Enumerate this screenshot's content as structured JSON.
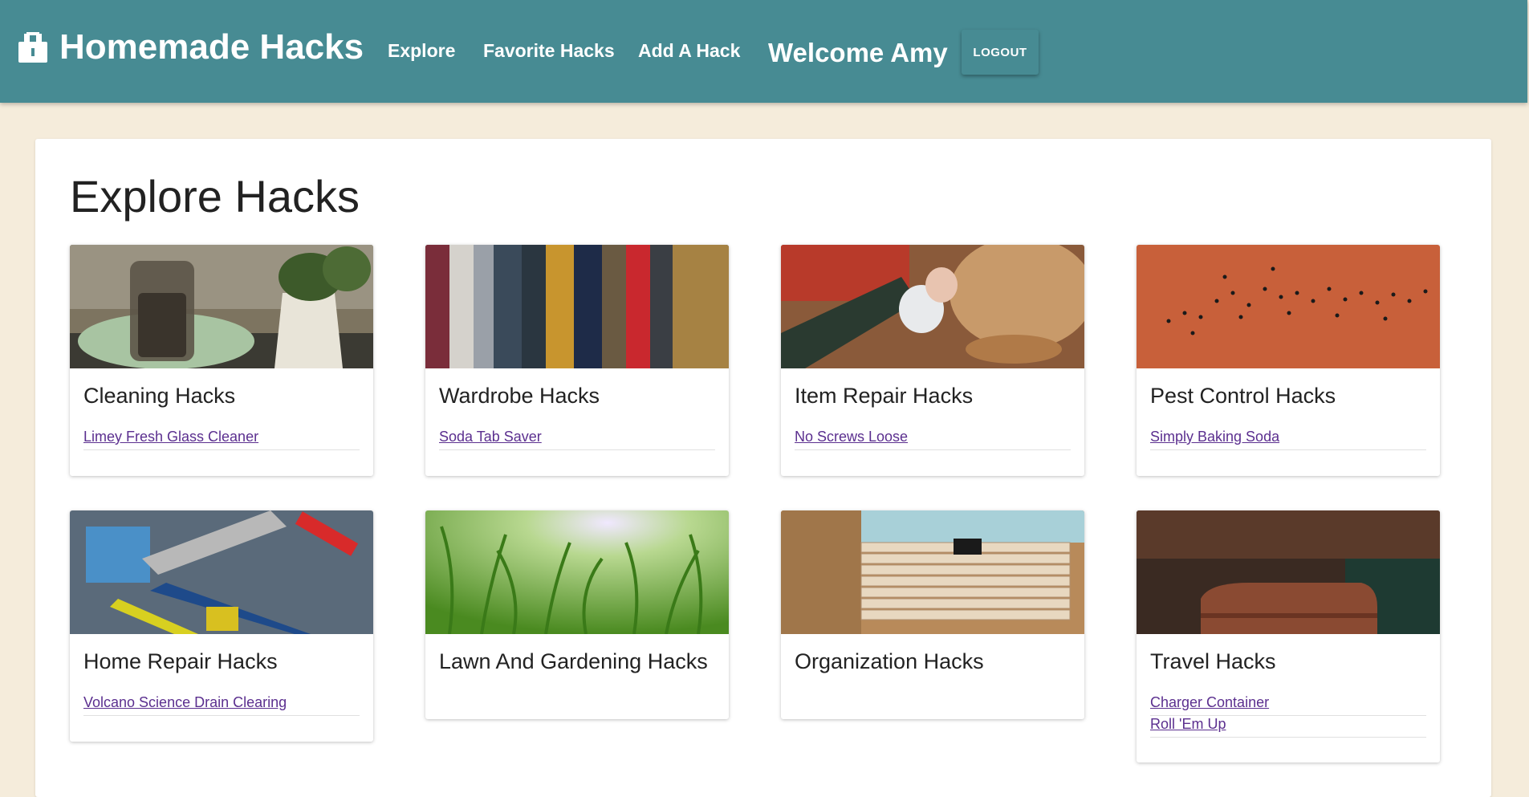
{
  "header": {
    "brand": "Homemade Hacks",
    "nav": [
      "Explore",
      "Favorite Hacks",
      "Add A Hack"
    ],
    "welcome": "Welcome Amy",
    "logout": "LOGOUT",
    "bg_color": "#478b93"
  },
  "main": {
    "title": "Explore Hacks",
    "cards": [
      {
        "title": "Cleaning Hacks",
        "image": "spray-bottle-plant-image",
        "links": [
          "Limey Fresh Glass Cleaner"
        ]
      },
      {
        "title": "Wardrobe Hacks",
        "image": "clothes-rack-image",
        "links": [
          "Soda Tab Saver"
        ]
      },
      {
        "title": "Item Repair Hacks",
        "image": "glue-gun-image",
        "links": [
          "No Screws Loose"
        ]
      },
      {
        "title": "Pest Control Hacks",
        "image": "ants-on-dirt-image",
        "links": [
          "Simply Baking Soda"
        ]
      },
      {
        "title": "Home Repair Hacks",
        "image": "tools-image",
        "links": [
          "Volcano Science Drain Clearing"
        ]
      },
      {
        "title": "Lawn And Gardening Hacks",
        "image": "grass-image",
        "links": []
      },
      {
        "title": "Organization Hacks",
        "image": "file-organizer-image",
        "links": []
      },
      {
        "title": "Travel Hacks",
        "image": "suitcase-image",
        "links": [
          "Charger Container",
          "Roll 'Em Up"
        ]
      }
    ]
  },
  "colors": {
    "page_bg": "#f5ecdb",
    "link": "#5b2f8f"
  }
}
